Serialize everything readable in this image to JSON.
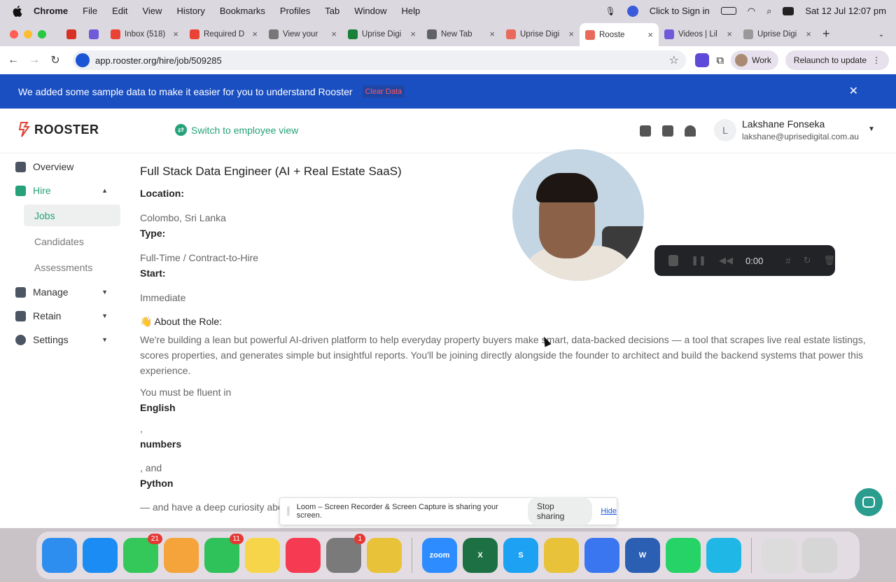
{
  "menubar": {
    "app": "Chrome",
    "items": [
      "File",
      "Edit",
      "View",
      "History",
      "Bookmarks",
      "Profiles",
      "Tab",
      "Window",
      "Help"
    ],
    "click_to_sign_in": "Click to Sign in",
    "datetime": "Sat 12 Jul  12:07 pm"
  },
  "tabs": [
    {
      "label": "",
      "fav_color": "#d93025",
      "pinned": true
    },
    {
      "label": "",
      "fav_color": "#6f5bd9",
      "pinned": true
    },
    {
      "label": "Inbox (518)",
      "fav_color": "#ea4335"
    },
    {
      "label": "Required D",
      "fav_color": "#ea4335"
    },
    {
      "label": "View your",
      "fav_color": "#777777"
    },
    {
      "label": "Uprise Digi",
      "fav_color": "#188038"
    },
    {
      "label": "New Tab",
      "fav_color": "#5f6368"
    },
    {
      "label": "Uprise Digi",
      "fav_color": "#e86a5a"
    },
    {
      "label": "Rooste",
      "fav_color": "#e86a5a",
      "active": true
    },
    {
      "label": "Videos | Lil",
      "fav_color": "#6f5bd9"
    },
    {
      "label": "Uprise Digi",
      "fav_color": "#999999"
    }
  ],
  "toolbar": {
    "url": "app.rooster.org/hire/job/509285",
    "profile": "Work",
    "relaunch": "Relaunch to update"
  },
  "banner": {
    "message": "We added some sample data to make it easier for you to understand Rooster",
    "clear": "Clear Data"
  },
  "header": {
    "logo": "ROOSTER",
    "switch_view": "Switch to employee view",
    "user_initial": "L",
    "user_name": "Lakshane Fonseka",
    "user_email": "lakshane@uprisedigital.com.au"
  },
  "sidebar": {
    "overview": "Overview",
    "hire": "Hire",
    "jobs": "Jobs",
    "candidates": "Candidates",
    "assessments": "Assessments",
    "manage": "Manage",
    "retain": "Retain",
    "settings": "Settings"
  },
  "job": {
    "title": "Full Stack Data Engineer (AI + Real Estate SaaS)",
    "location_label": "Location:",
    "location": "Colombo, Sri Lanka",
    "type_label": "Type:",
    "type": "Full-Time / Contract-to-Hire",
    "start_label": "Start:",
    "start": "Immediate",
    "about_label": "👋 About the Role:",
    "about": "We're building a lean but powerful AI-driven platform to help everyday property buyers make smart, data-backed decisions — a tool that scrapes live real estate listings, scores properties, and generates simple but insightful reports. You'll be joining directly alongside the founder to architect and build the backend systems that power this experience.",
    "fluent": "You must be fluent in",
    "skill1": "English",
    "sep1": ",",
    "skill2": "numbers",
    "sep2": ", and",
    "skill3": "Python",
    "tail": "— and have a deep curiosity about property data, scoring models, and how people make decisions."
  },
  "loom": {
    "time": "0:00",
    "share_msg": "Loom – Screen Recorder & Screen Capture is sharing your screen.",
    "stop": "Stop sharing",
    "hide": "Hide"
  },
  "dock": [
    {
      "name": "finder",
      "color": "#2e8ef0",
      "label": ""
    },
    {
      "name": "app-store",
      "color": "#1b8cf3",
      "label": ""
    },
    {
      "name": "messages",
      "color": "#34c759",
      "label": "",
      "badge": "21"
    },
    {
      "name": "photos",
      "color": "#f4a43a",
      "label": ""
    },
    {
      "name": "facetime",
      "color": "#30c25a",
      "label": "",
      "badge": "11"
    },
    {
      "name": "notes",
      "color": "#f7d54a",
      "label": ""
    },
    {
      "name": "music",
      "color": "#f53a52",
      "label": ""
    },
    {
      "name": "system-settings",
      "color": "#7a7a7a",
      "label": "",
      "badge": "1"
    },
    {
      "name": "chrome",
      "color": "#e8c238",
      "label": ""
    },
    {
      "name": "zoom",
      "color": "#2d8cff",
      "label": "zoom"
    },
    {
      "name": "excel",
      "color": "#1d7044",
      "label": "X"
    },
    {
      "name": "skype",
      "color": "#1da1f2",
      "label": "S"
    },
    {
      "name": "chrome-2",
      "color": "#e8c238",
      "label": ""
    },
    {
      "name": "signal",
      "color": "#3a76f0",
      "label": ""
    },
    {
      "name": "word",
      "color": "#2b5fb3",
      "label": "W"
    },
    {
      "name": "whatsapp",
      "color": "#25d366",
      "label": ""
    },
    {
      "name": "app-dark",
      "color": "#1fb7e6",
      "label": ""
    },
    {
      "name": "downloads",
      "color": "#dcdcdc",
      "label": ""
    },
    {
      "name": "trash",
      "color": "#d6d6d6",
      "label": ""
    }
  ]
}
